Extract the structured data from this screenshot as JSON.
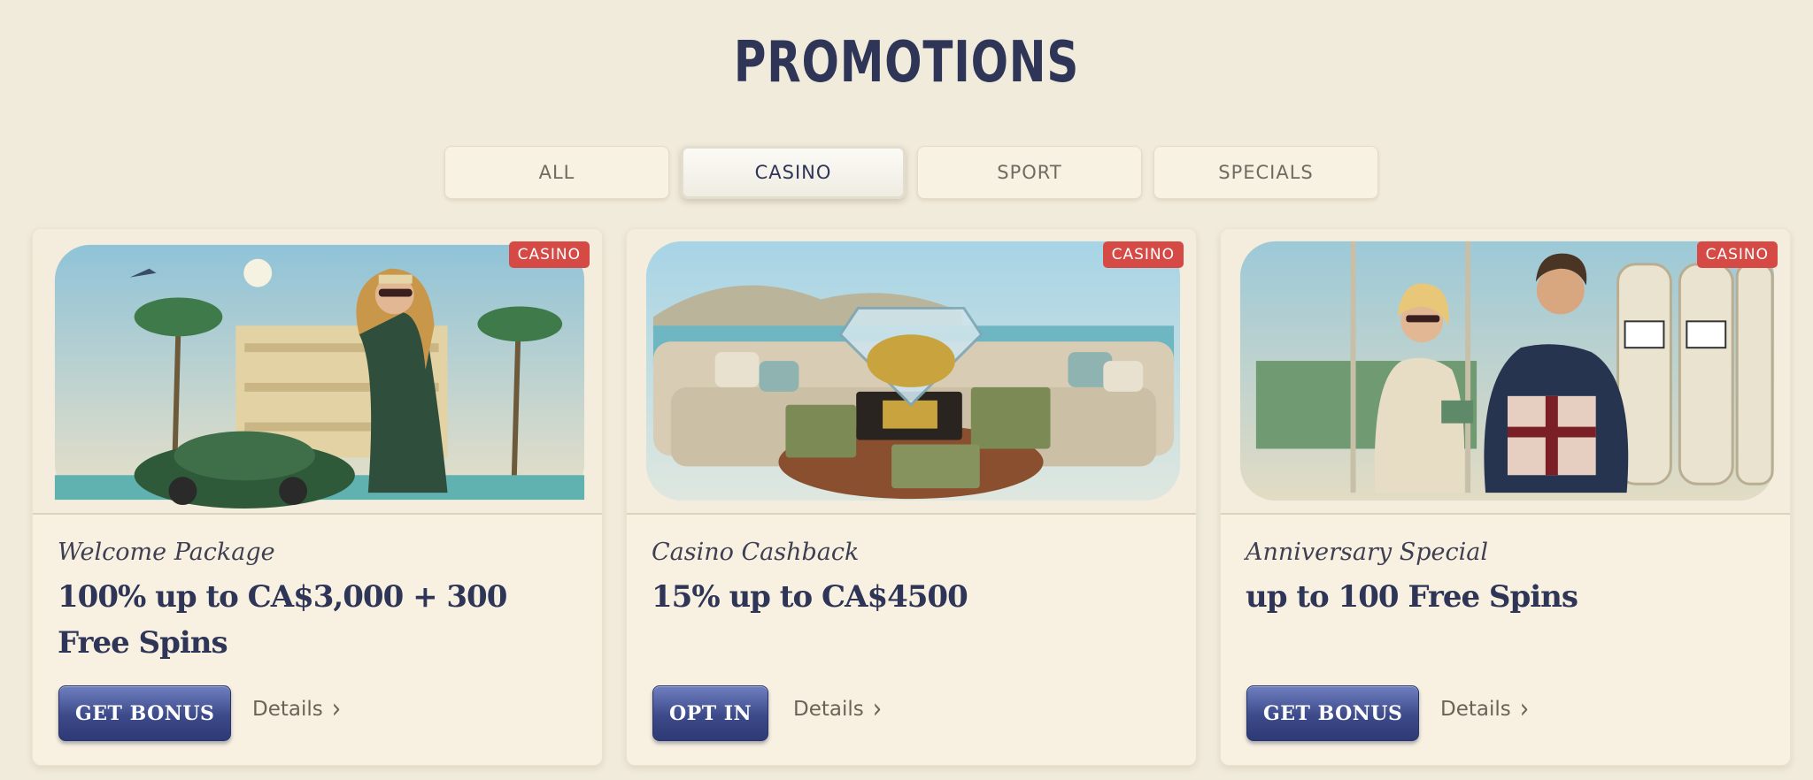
{
  "page": {
    "title": "PROMOTIONS"
  },
  "tabs": [
    {
      "label": "ALL",
      "active": false
    },
    {
      "label": "CASINO",
      "active": true
    },
    {
      "label": "SPORT",
      "active": false
    },
    {
      "label": "SPECIALS",
      "active": false
    }
  ],
  "promos": [
    {
      "badge": "CASINO",
      "image": "woman-with-green-sports-car-by-beach-villa",
      "subtitle": "Welcome Package",
      "headline": "100% up to CA$3,000 + 300 Free Spins",
      "cta": "GET BONUS",
      "details": "Details"
    },
    {
      "badge": "CASINO",
      "image": "vip-diamond-jar-with-cash-stacks",
      "subtitle": "Casino Cashback",
      "headline": "15% up to CA$4500",
      "cta": "OPT IN",
      "details": "Details"
    },
    {
      "badge": "CASINO",
      "image": "couple-with-gift-and-slot-machines",
      "subtitle": "Anniversary Special",
      "headline": "up to 100 Free Spins",
      "cta": "GET BONUS",
      "details": "Details"
    }
  ],
  "icons": {
    "details_arrow": "chevron-right-icon"
  },
  "colors": {
    "accent": "#2e3557",
    "badge": "#d64a46",
    "button": "#3d4a8a",
    "background": "#f1ebdc"
  }
}
